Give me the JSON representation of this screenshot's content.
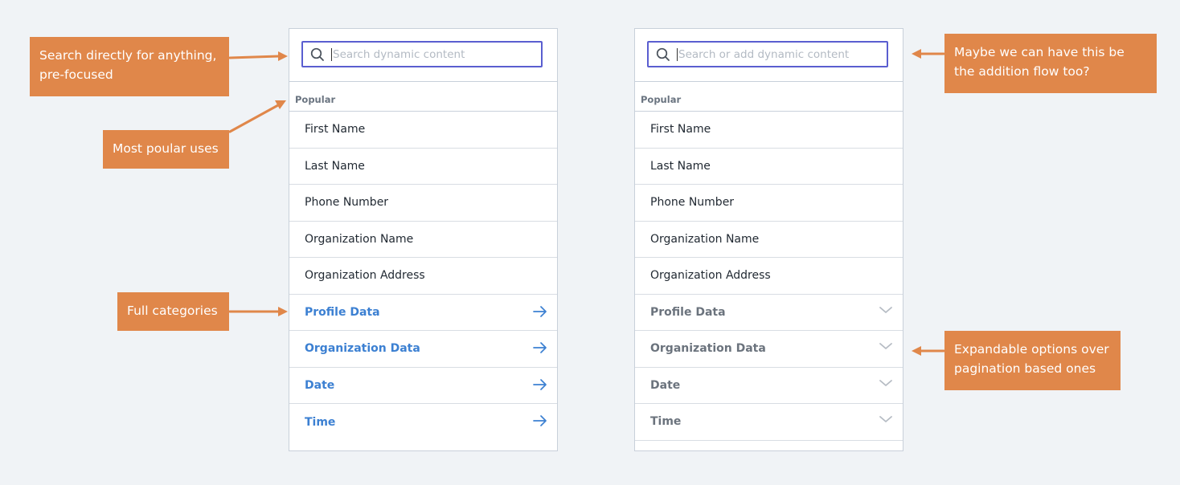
{
  "left_panel": {
    "search_placeholder": "Search dynamic content",
    "section_label": "Popular",
    "popular_items": [
      "First Name",
      "Last Name",
      "Phone Number",
      "Organization Name",
      "Organization Address"
    ],
    "category_items": [
      "Profile Data",
      "Organization Data",
      "Date",
      "Time"
    ],
    "category_indicator_icon": "arrow-right-icon"
  },
  "right_panel": {
    "search_placeholder": "Search or add dynamic content",
    "section_label": "Popular",
    "popular_items": [
      "First Name",
      "Last Name",
      "Phone Number",
      "Organization Name",
      "Organization Address"
    ],
    "category_items": [
      "Profile Data",
      "Organization Data",
      "Date",
      "Time"
    ],
    "category_indicator_icon": "chevron-down-icon"
  },
  "callouts": {
    "search_note": "Search directly for anything, pre-focused",
    "popular_note": "Most poular uses",
    "categories_note": "Full categories",
    "addition_note": "Maybe we can have this be the addition flow too?",
    "expandable_note": "Expandable options over pagination based ones"
  },
  "colors": {
    "background": "#f0f3f6",
    "callout": "#e0874a",
    "link": "#3c80d2",
    "search_border": "#5a5ed0"
  }
}
